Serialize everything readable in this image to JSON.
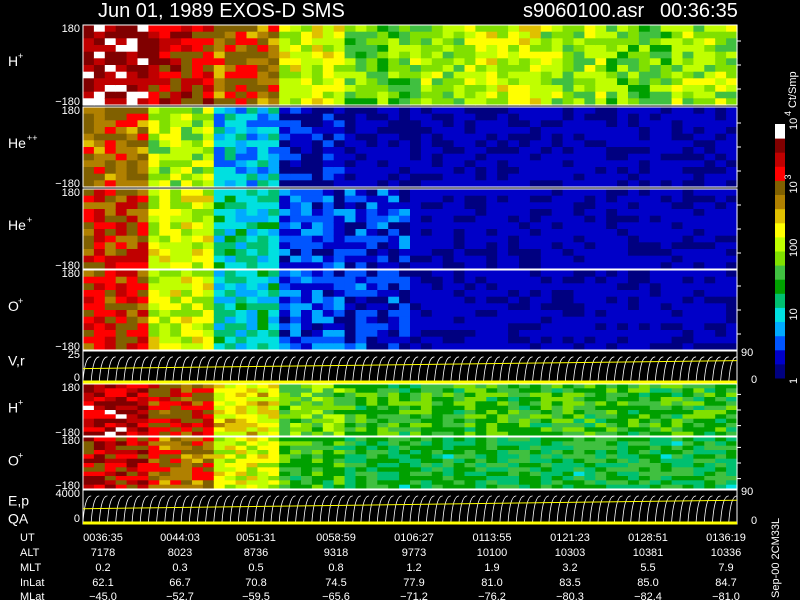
{
  "chart_data": {
    "type": "heatmap",
    "title": "Jun 01, 1989   EXOS-D SMS",
    "file": "s9060100.asr",
    "file_time": "00:36:35",
    "colorbar": {
      "label": "Ct/Smp",
      "scale": "log",
      "range": [
        1,
        10000
      ],
      "ticks": [
        "1",
        "10",
        "100",
        "10",
        "10"
      ],
      "tick_exponents": [
        "",
        "",
        "",
        "3",
        "4"
      ],
      "colors": [
        "#000080",
        "#0000c8",
        "#0055ff",
        "#00aaff",
        "#00e0e0",
        "#00c070",
        "#00a000",
        "#40c040",
        "#80e000",
        "#c0ff00",
        "#ffff00",
        "#e0c000",
        "#b08000",
        "#806000",
        "#ff0000",
        "#c00000",
        "#800000",
        "#ffffff"
      ]
    },
    "panels": [
      {
        "label": "H",
        "charge": "+",
        "ymax": "180",
        "ymin": "−180",
        "activity": [
          0.95,
          0.85,
          0.75,
          0.55,
          0.45,
          0.5,
          0.55,
          0.5,
          0.45,
          0.5
        ]
      },
      {
        "label": "He",
        "charge": "++",
        "ymax": "180",
        "ymin": "−180",
        "activity": [
          0.75,
          0.5,
          0.2,
          0.05,
          0.02,
          0.01,
          0.01,
          0.01,
          0.01,
          0.01
        ]
      },
      {
        "label": "He",
        "charge": "+",
        "ymax": "180",
        "ymin": "−180",
        "activity": [
          0.8,
          0.55,
          0.25,
          0.1,
          0.08,
          0.03,
          0.02,
          0.02,
          0.02,
          0.02
        ]
      },
      {
        "label": "O",
        "charge": "+",
        "ymax": "180",
        "ymin": "−180",
        "activity": [
          0.8,
          0.55,
          0.25,
          0.1,
          0.08,
          0.03,
          0.02,
          0.02,
          0.02,
          0.02
        ]
      },
      {
        "label": "H",
        "charge": "+",
        "ymax": "180",
        "ymin": "−180",
        "activity": [
          0.9,
          0.8,
          0.6,
          0.45,
          0.4,
          0.4,
          0.4,
          0.4,
          0.4,
          0.4
        ]
      },
      {
        "label": "O",
        "charge": "+",
        "ymax": "180",
        "ymin": "−180",
        "activity": [
          0.85,
          0.75,
          0.55,
          0.4,
          0.35,
          0.35,
          0.35,
          0.35,
          0.35,
          0.35
        ]
      }
    ],
    "vr_panel": {
      "label": "V,r",
      "ytick_left": "25",
      "ytick_left_low": "0",
      "ytick_right": "90",
      "ytick_right_low": "0"
    },
    "ep_panel": {
      "label": "E,p",
      "label2": "QA",
      "ytick_left": "4000",
      "ytick_left_low": "0",
      "ytick_right": "90",
      "ytick_right_low": "0"
    },
    "side_label": "Sep-00  2CM33L",
    "table": {
      "rows": [
        {
          "name": "UT",
          "values": [
            "0036:35",
            "0044:03",
            "0051:31",
            "0058:59",
            "0106:27",
            "0113:55",
            "0121:23",
            "0128:51",
            "0136:19"
          ]
        },
        {
          "name": "ALT",
          "values": [
            "7178",
            "8023",
            "8736",
            "9318",
            "9773",
            "10100",
            "10303",
            "10381",
            "10336"
          ]
        },
        {
          "name": "MLT",
          "values": [
            "0.2",
            "0.3",
            "0.5",
            "0.8",
            "1.2",
            "1.9",
            "3.2",
            "5.5",
            "7.9"
          ]
        },
        {
          "name": "InLat",
          "values": [
            "62.1",
            "66.7",
            "70.8",
            "74.5",
            "77.9",
            "81.0",
            "83.5",
            "85.0",
            "84.7"
          ]
        },
        {
          "name": "MLat",
          "values": [
            "−45.0",
            "−52.7",
            "−59.5",
            "−65.6",
            "−71.2",
            "−76.2",
            "−80.3",
            "−82.4",
            "−81.0"
          ]
        }
      ]
    }
  }
}
